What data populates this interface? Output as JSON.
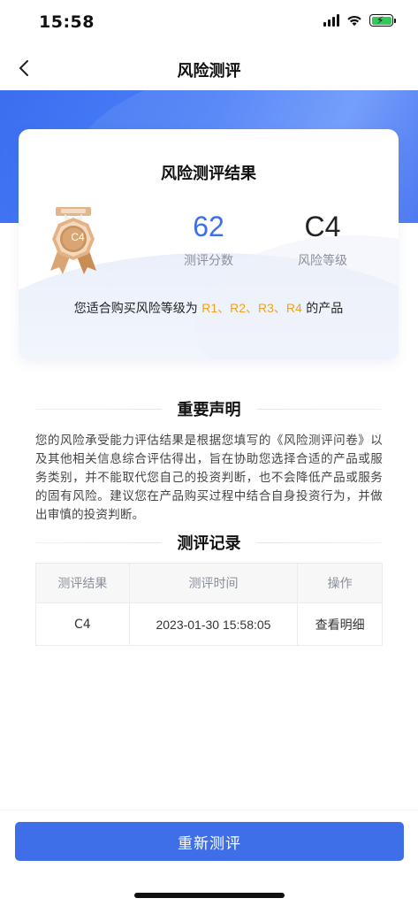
{
  "status_bar": {
    "time": "15:58"
  },
  "nav": {
    "title": "风险测评"
  },
  "result_card": {
    "title": "风险测评结果",
    "medal_text": "C4",
    "score_value": "62",
    "score_label": "测评分数",
    "level_value": "C4",
    "level_label": "风险等级",
    "suit_prefix": "您适合购买风险等级为",
    "suit_levels": "R1、R2、R3、R4",
    "suit_suffix": "的产品"
  },
  "statement": {
    "heading": "重要声明",
    "text": "您的风险承受能力评估结果是根据您填写的《风险测评问卷》以及其他相关信息综合评估得出，旨在协助您选择合适的产品或服务类别，并不能取代您自己的投资判断，也不会降低产品或服务的固有风险。建议您在产品购买过程中结合自身投资行为，并做出审慎的投资判断。"
  },
  "records": {
    "heading": "测评记录",
    "columns": [
      "测评结果",
      "测评时间",
      "操作"
    ],
    "rows": [
      {
        "result": "C4",
        "time": "2023-01-30 15:58:05",
        "action": "查看明细"
      }
    ]
  },
  "bottom": {
    "retest_label": "重新测评"
  },
  "colors": {
    "primary": "#3f6fe8",
    "accent_orange": "#f0a21b",
    "score_blue": "#3b6ef0"
  }
}
